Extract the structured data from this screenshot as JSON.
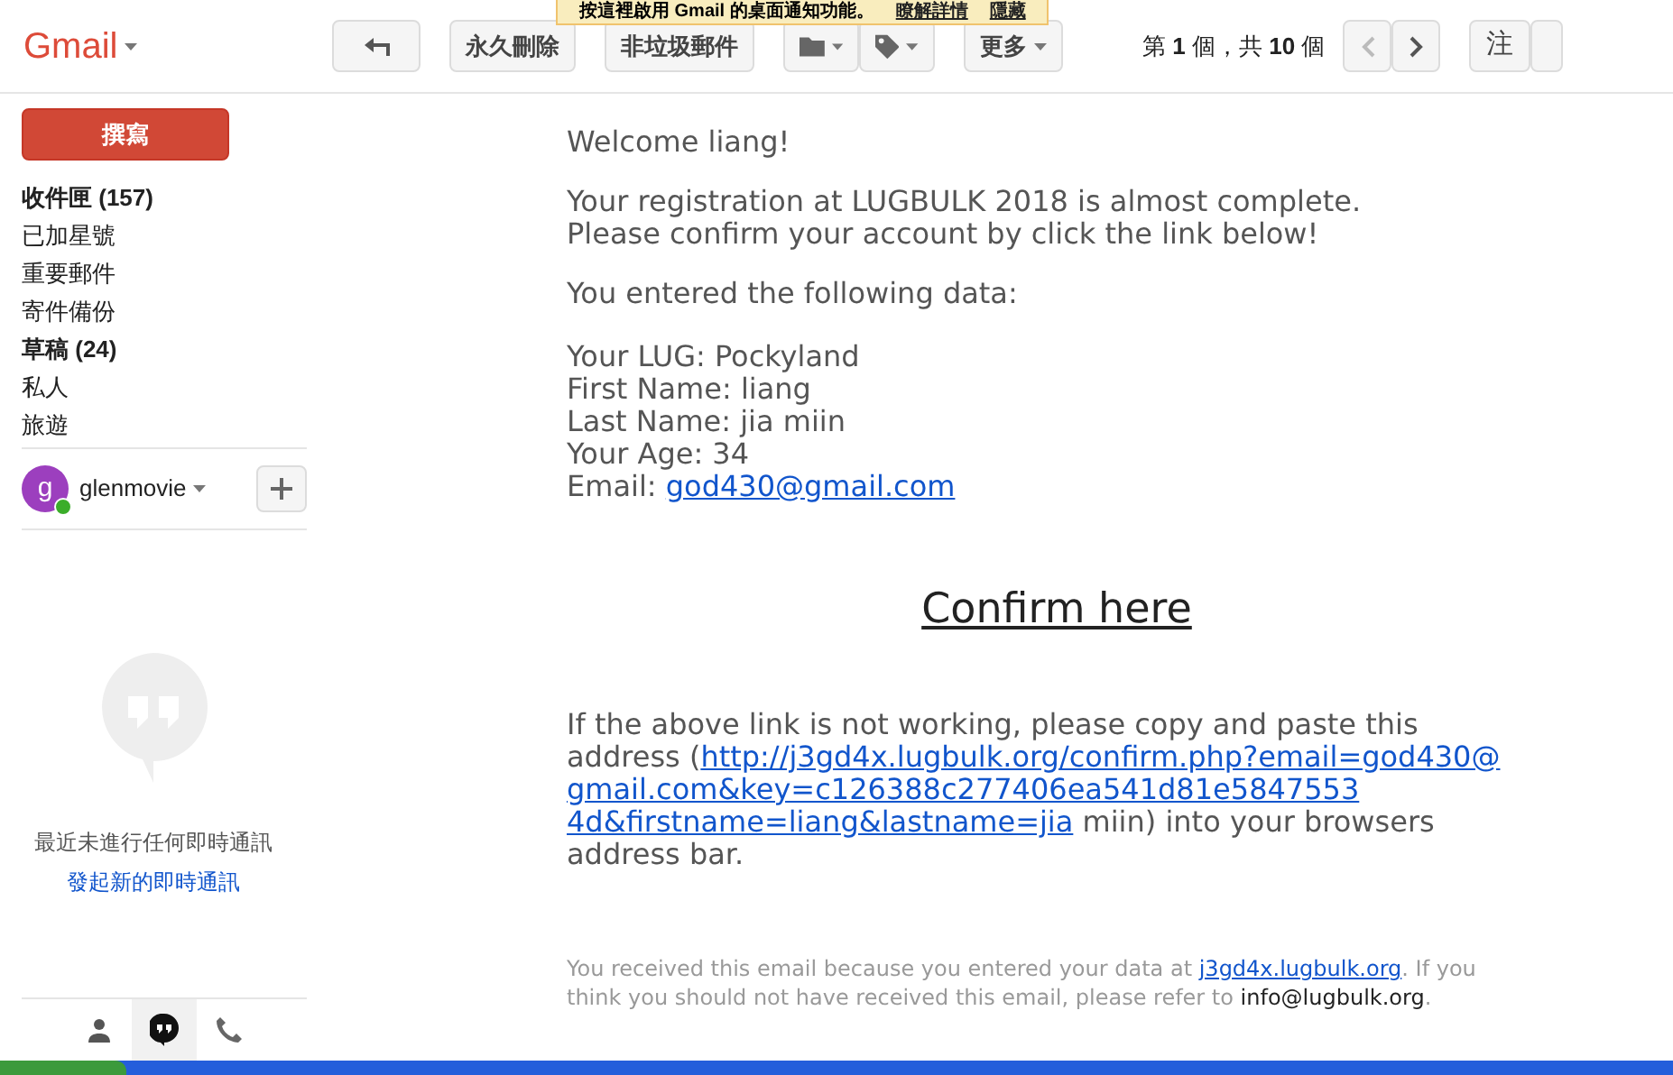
{
  "notification": {
    "text": "按這裡啟用 Gmail 的桌面通知功能。",
    "links": [
      "瞭解詳情",
      "隱藏"
    ]
  },
  "app_name": "Gmail",
  "toolbar": {
    "buttons": [
      "永久刪除",
      "非垃圾郵件",
      "更多"
    ],
    "pager": "第 **1** 個，共 **10** 個",
    "settings": "注"
  },
  "sidebar": {
    "compose": "撰寫",
    "folders": [
      {
        "label": "收件匣 (157)",
        "unread": true
      },
      {
        "label": "已加星號",
        "unread": false
      },
      {
        "label": "重要郵件",
        "unread": false
      },
      {
        "label": "寄件備份",
        "unread": false
      },
      {
        "label": "草稿 (24)",
        "unread": true
      },
      {
        "label": "私人",
        "unread": false
      },
      {
        "label": "旅遊",
        "unread": false
      }
    ],
    "account": {
      "initial": "g",
      "name": "glenmovie",
      "online": true
    },
    "hangouts": {
      "empty": "最近未進行任何即時通訊",
      "start": "發起新的即時通訊"
    },
    "tabs": [
      {
        "kind": "person",
        "selected": false
      },
      {
        "kind": "hangouts",
        "selected": true
      },
      {
        "kind": "phone",
        "selected": false
      }
    ]
  },
  "email": {
    "greeting": "Welcome liang!",
    "intro": [
      "Your registration at LUGBULK 2018 is almost complete.",
      "Please confirm your account by click the link below!"
    ],
    "data_heading": "You entered the following data:",
    "fields": [
      "Your LUG: Pockyland",
      "First Name: liang",
      "Last Name: jia miin",
      "Your Age: 34"
    ],
    "email_label": "Email: ",
    "email_link": "god430@gmail.com",
    "confirm": "Confirm here",
    "fallback_lines": [
      [
        {
          "kind": "text",
          "text": "If the above link is not working, please copy and paste this"
        }
      ],
      [
        {
          "kind": "text",
          "text": "address ("
        },
        {
          "kind": "link",
          "text": "http://j3gd4x.lugbulk.org/confirm.php?email=god430@"
        }
      ],
      [
        {
          "kind": "link",
          "text": "gmail.com&key=c126388c277406ea541d81e5847553"
        }
      ],
      [
        {
          "kind": "link",
          "text": "4d&firstname=liang&lastname=jia"
        },
        {
          "kind": "text",
          "text": " miin) into your browsers"
        }
      ],
      [
        {
          "kind": "text",
          "text": "address bar."
        }
      ]
    ],
    "footer_before": "You received this email because you entered your data at ",
    "footer_link": "j3gd4x.lugbulk.org",
    "footer_after": ". If you think you should not have received this email, please refer to ",
    "footer_email": "info@lugbulk.org",
    "footer_end": "."
  }
}
